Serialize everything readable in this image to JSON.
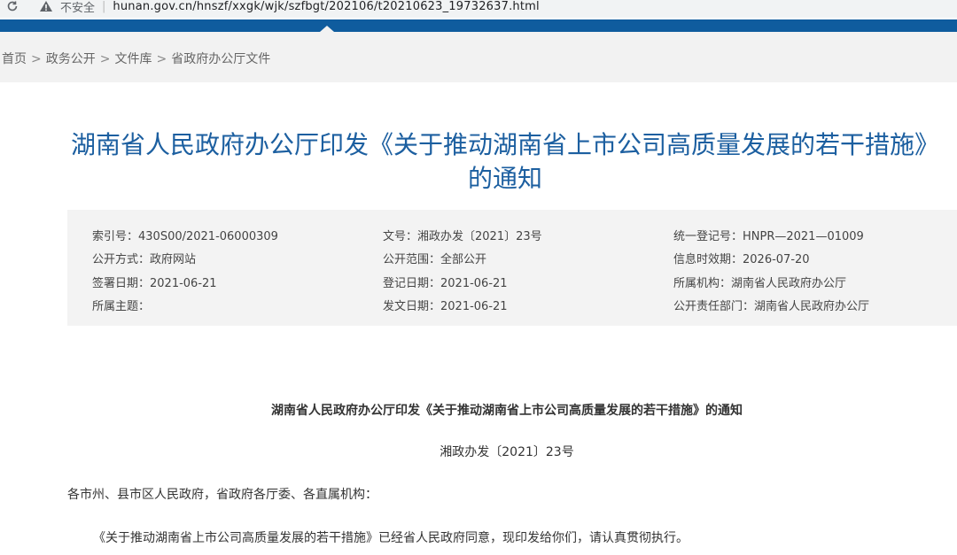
{
  "browser": {
    "security_label": "不安全",
    "url": "hunan.gov.cn/hnszf/xxgk/wjk/szfbgt/202106/t20210623_19732637.html"
  },
  "breadcrumb": {
    "items": [
      "首页",
      "政务公开",
      "文件库",
      "省政府办公厅文件"
    ],
    "separator": ">"
  },
  "title": {
    "line1": "湖南省人民政府办公厅印发《关于推动湖南省上市公司高质量发展的若干措施》",
    "line2": "的通知"
  },
  "info": {
    "index_no": "索引号：430S00/2021-06000309",
    "doc_no": "文号：湘政办发〔2021〕23号",
    "reg_no": "统一登记号：HNPR—2021—01009",
    "open_method": "公开方式：政府网站",
    "open_scope": "公开范围：全部公开",
    "validity": "信息时效期：2026-07-20",
    "sign_date": "签署日期：2021-06-21",
    "record_date": "登记日期：2021-06-21",
    "org": "所属机构：湖南省人民政府办公厅",
    "topic": "所属主题：",
    "issue_date": "发文日期：2021-06-21",
    "dept": "公开责任部门：湖南省人民政府办公厅"
  },
  "body": {
    "doc_title": "湖南省人民政府办公厅印发《关于推动湖南省上市公司高质量发展的若干措施》的通知",
    "doc_number": "湘政办发〔2021〕23号",
    "salutation": "各市州、县市区人民政府，省政府各厅委、各直属机构：",
    "paragraph1": "《关于推动湖南省上市公司高质量发展的若干措施》已经省人民政府同意，现印发给你们，请认真贯彻执行。"
  }
}
